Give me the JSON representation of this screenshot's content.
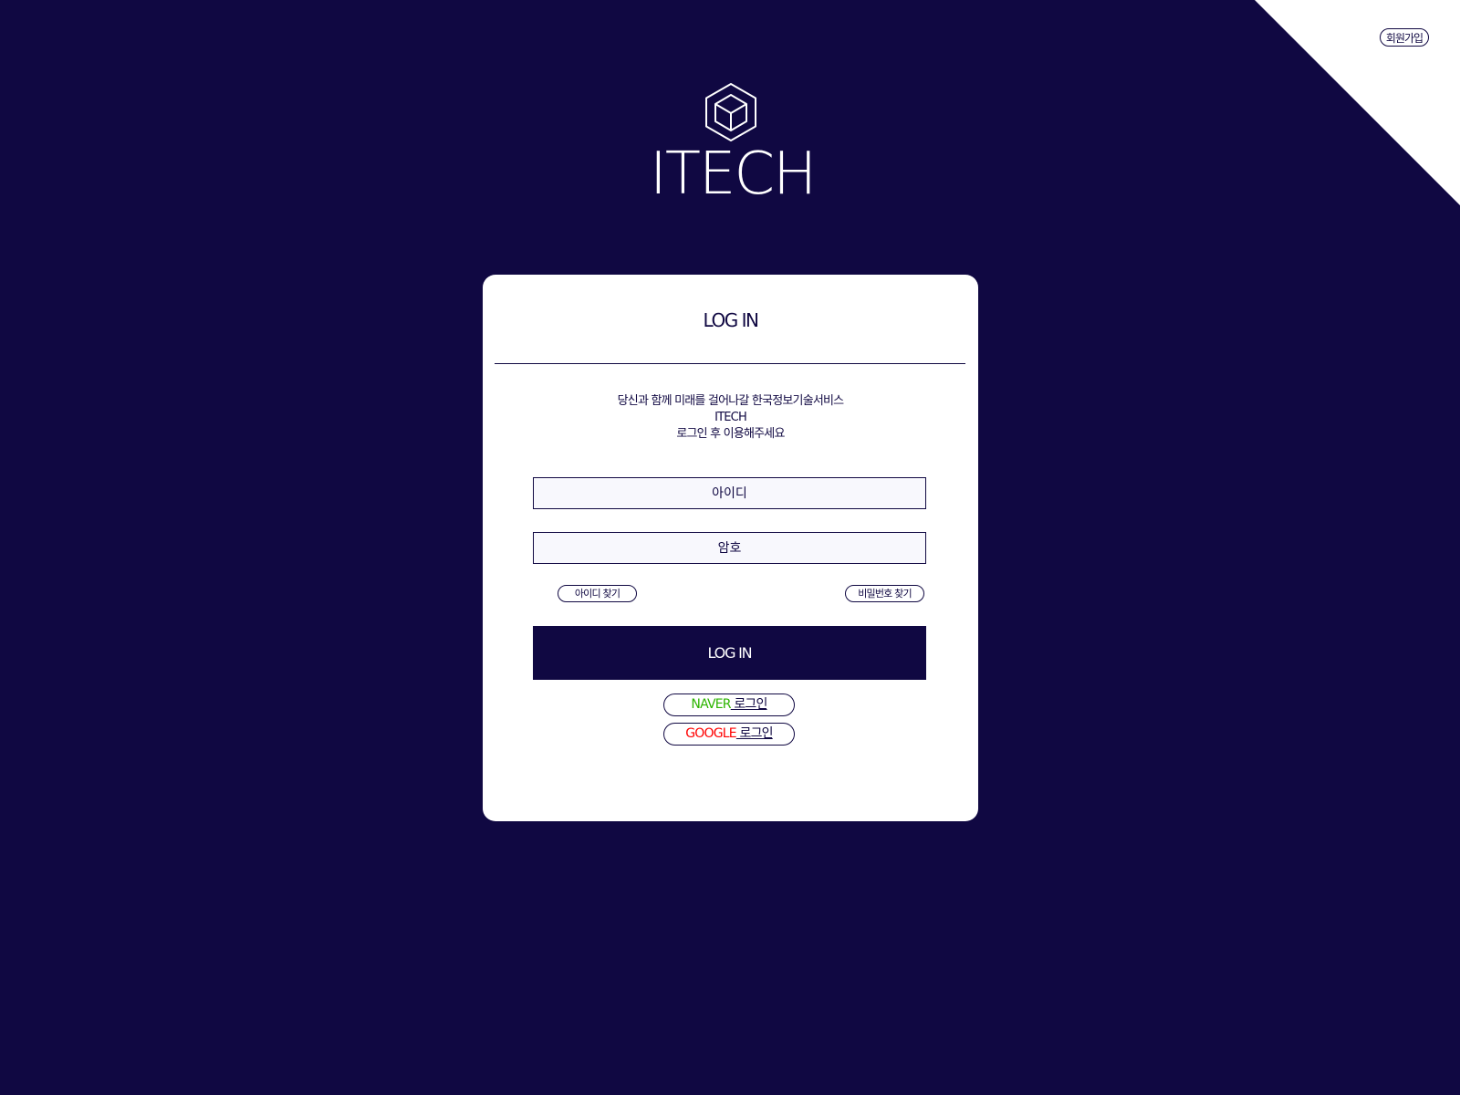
{
  "header": {
    "signup_label": "회원가입"
  },
  "logo": {
    "icon": "cube-hexagon-icon",
    "text": "ITECH"
  },
  "login": {
    "title": "LOG IN",
    "message_lines": [
      "당신과 함께 미래를 걸어나갈 한국정보기술서비스",
      "ITECH",
      "로그인 후 이용해주세요"
    ],
    "id_placeholder": "아이디",
    "password_placeholder": "암호",
    "find_id_label": "아이디 찾기",
    "find_password_label": "비밀번호 찾기",
    "submit_label": "LOG IN",
    "social": {
      "naver": {
        "brand": "NAVER",
        "suffix": " 로그인",
        "brand_color": "#2db400"
      },
      "google": {
        "brand": "GOOGLE",
        "suffix": " 로그인",
        "brand_color": "#ff0000"
      }
    }
  },
  "colors": {
    "background": "#100842",
    "card": "#ffffff",
    "accent": "#100842",
    "input_fill": "#f8f8fd"
  }
}
